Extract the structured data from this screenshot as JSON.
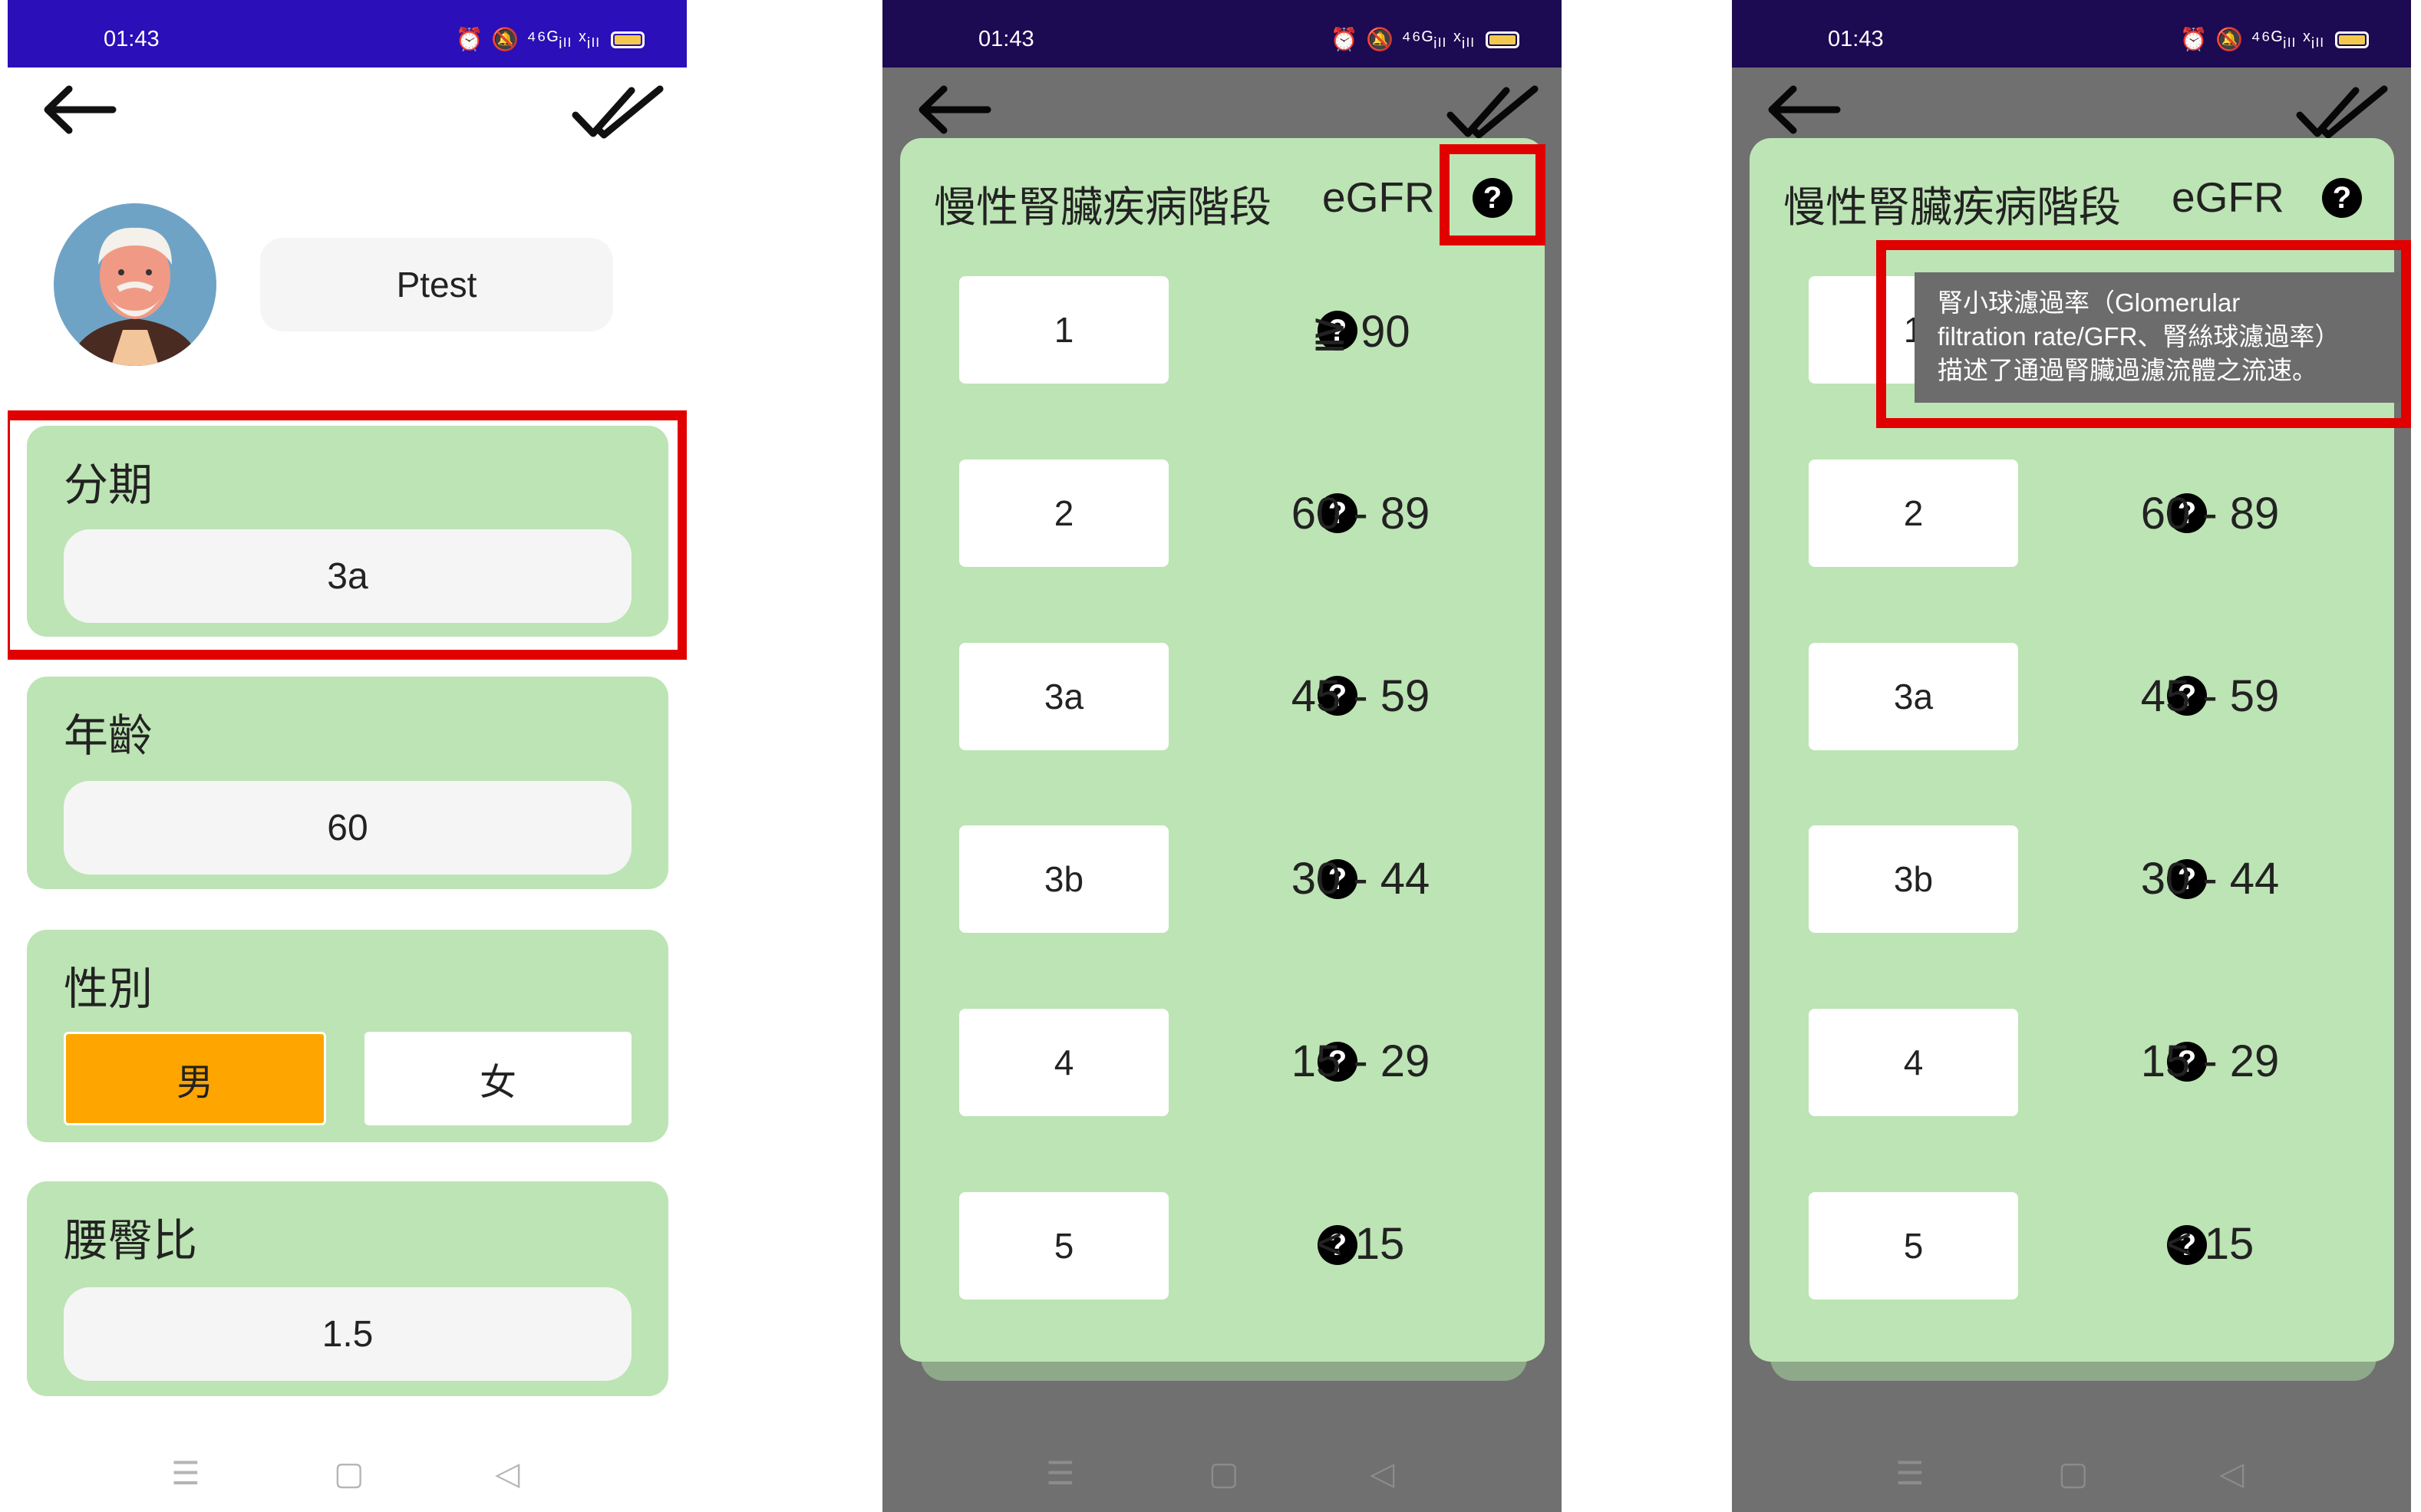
{
  "status": {
    "time": "01:43",
    "icons_text": "⏰ 🔕 ⁴⁶ᴳᵢₗₗ ˣᵢₗₗ"
  },
  "panel1": {
    "name": "Ptest",
    "stage": {
      "label": "分期",
      "value": "3a"
    },
    "age": {
      "label": "年齡",
      "value": "60"
    },
    "sex": {
      "label": "性別",
      "male": "男",
      "female": "女",
      "selected": "男"
    },
    "whr": {
      "label": "腰臀比",
      "value": "1.5"
    }
  },
  "dialog": {
    "title": "慢性腎臟疾病階段",
    "egfr": "eGFR",
    "rows": [
      {
        "stage": "1",
        "range": "≧ 90"
      },
      {
        "stage": "2",
        "range": "60 - 89"
      },
      {
        "stage": "3a",
        "range": "45 - 59"
      },
      {
        "stage": "3b",
        "range": "30 - 44"
      },
      {
        "stage": "4",
        "range": "15 - 29"
      },
      {
        "stage": "5",
        "range": "<  15"
      }
    ],
    "tooltip": {
      "line1": "腎小球濾過率（Glomerular",
      "line2": "filtration rate/GFR、腎絲球濾過率）",
      "line3": "描述了通過腎臟過濾流體之流速。"
    }
  },
  "nav": {
    "menu": "☰",
    "home": "▢",
    "back": "◁"
  },
  "colors": {
    "accent": "#ffa500",
    "card": "#bde4b4",
    "highlight": "#e00000",
    "statusbar": "#2b0fb8"
  }
}
